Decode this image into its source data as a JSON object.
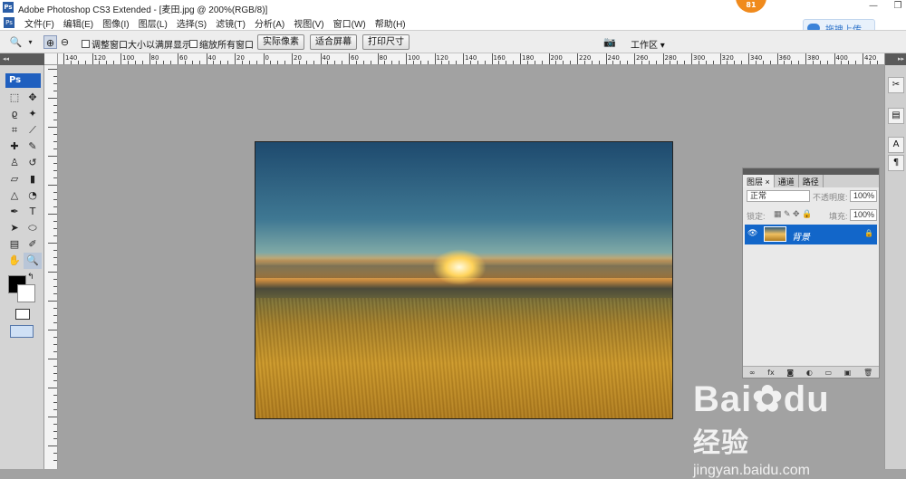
{
  "app": {
    "title": "Adobe Photoshop CS3 Extended - [麦田.jpg @ 200%(RGB/8)]",
    "logo_text": "Ps",
    "notification_count": "81",
    "upload_button_label": "拖拽上传"
  },
  "menu": {
    "items": [
      "文件(F)",
      "编辑(E)",
      "图像(I)",
      "图层(L)",
      "选择(S)",
      "滤镜(T)",
      "分析(A)",
      "视图(V)",
      "窗口(W)",
      "帮助(H)"
    ]
  },
  "options_bar": {
    "resize_windows_label": "调整窗口大小以满屏显示",
    "zoom_all_windows_label": "缩放所有窗口",
    "actual_pixels_label": "实际像素",
    "fit_screen_label": "适合屏幕",
    "print_size_label": "打印尺寸",
    "workspace_label": "工作区 ▾"
  },
  "toolbox": {
    "logo": "Ps",
    "tools": [
      "marquee-icon",
      "move-icon",
      "lasso-icon",
      "magic-wand-icon",
      "crop-icon",
      "slice-icon",
      "healing-brush-icon",
      "brush-icon",
      "clone-stamp-icon",
      "history-brush-icon",
      "eraser-icon",
      "gradient-icon",
      "blur-icon",
      "dodge-icon",
      "pen-icon",
      "type-icon",
      "path-select-icon",
      "shape-icon",
      "notes-icon",
      "eyedropper-icon",
      "hand-icon",
      "zoom-icon"
    ],
    "foreground_color": "#000000",
    "background_color": "#ffffff"
  },
  "ruler": {
    "labels": [
      "140",
      "120",
      "100",
      "80",
      "60",
      "40",
      "20",
      "0",
      "20",
      "40",
      "60",
      "80",
      "100",
      "120",
      "140",
      "160",
      "180",
      "200",
      "220",
      "240",
      "260",
      "280",
      "300",
      "320",
      "340",
      "360",
      "380",
      "400",
      "420"
    ]
  },
  "layers_panel": {
    "tabs": [
      "图层 ×",
      "通道",
      "路径"
    ],
    "blend_mode": "正常",
    "opacity_label": "不透明度:",
    "opacity_value": "100%",
    "lock_label": "锁定:",
    "fill_label": "填充:",
    "fill_value": "100%",
    "layer_name": "背景"
  },
  "watermark": {
    "brand": "Bai",
    "brand_tail": "du",
    "brand_suffix": "经验",
    "url": "jingyan.baidu.com"
  }
}
